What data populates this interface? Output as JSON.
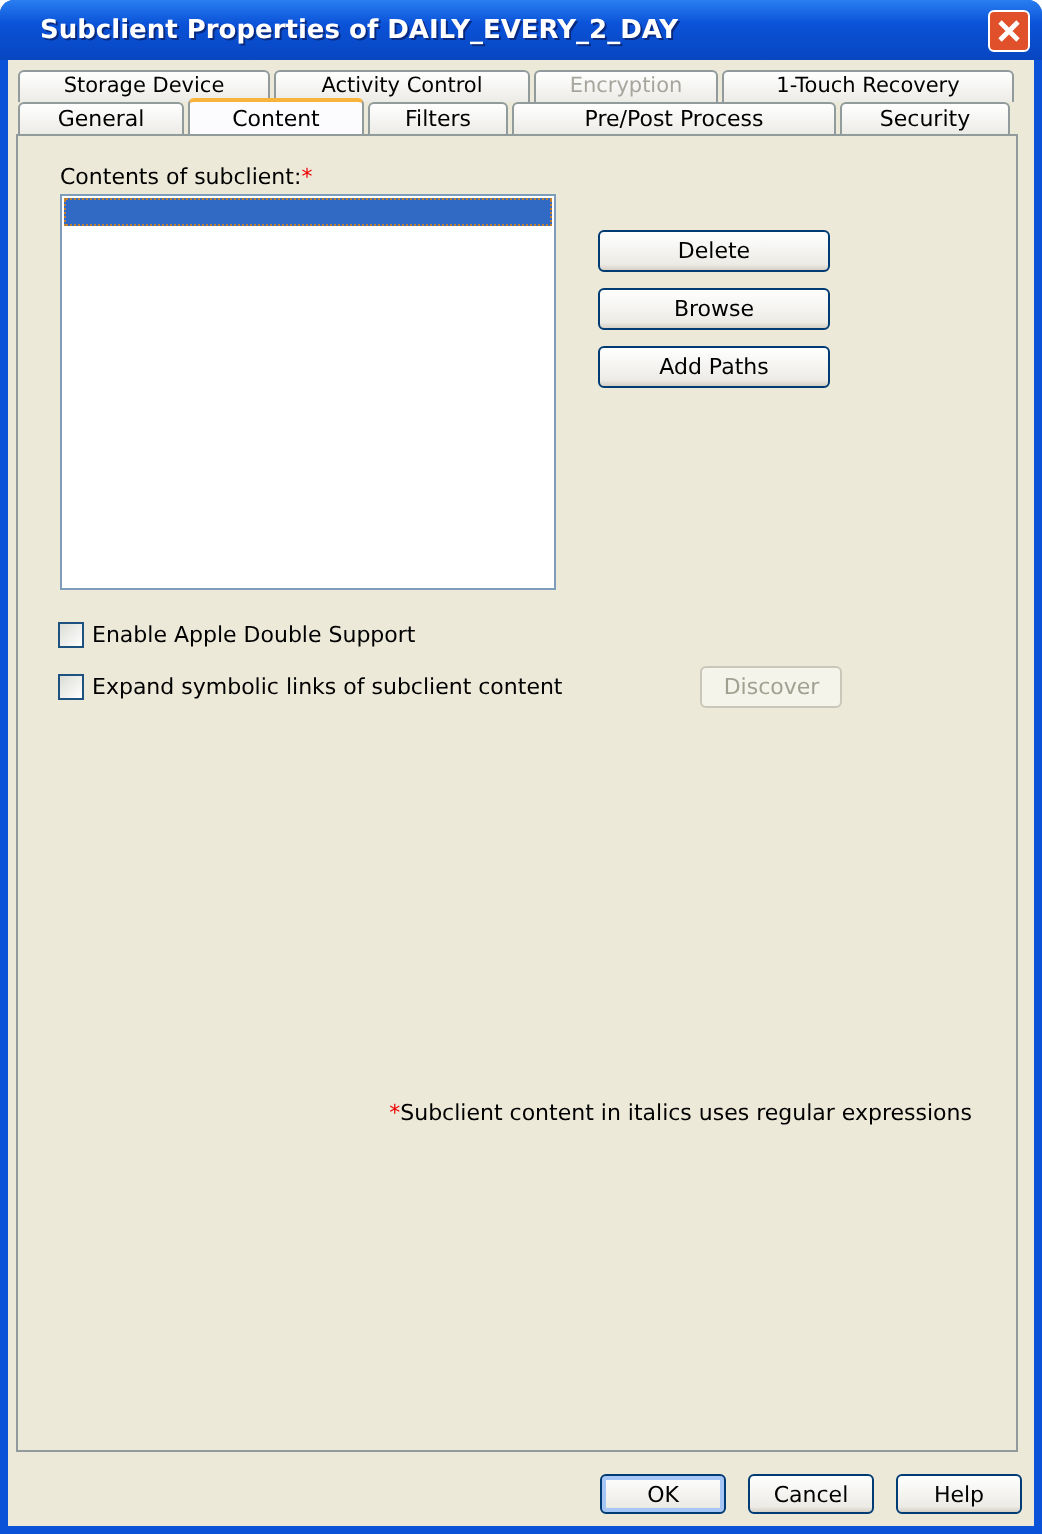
{
  "window": {
    "title": "Subclient Properties of DAILY_EVERY_2_DAY"
  },
  "tab_rows": [
    {
      "tabs": [
        {
          "label": "Storage Device",
          "selected": false,
          "disabled": false
        },
        {
          "label": "Activity Control",
          "selected": false,
          "disabled": false
        },
        {
          "label": "Encryption",
          "selected": false,
          "disabled": true
        },
        {
          "label": "1-Touch Recovery",
          "selected": false,
          "disabled": false
        }
      ]
    },
    {
      "tabs": [
        {
          "label": "General",
          "selected": false,
          "disabled": false
        },
        {
          "label": "Content",
          "selected": true,
          "disabled": false
        },
        {
          "label": "Filters",
          "selected": false,
          "disabled": false
        },
        {
          "label": "Pre/Post Process",
          "selected": false,
          "disabled": false
        },
        {
          "label": "Security",
          "selected": false,
          "disabled": false
        }
      ]
    }
  ],
  "contents": {
    "label": "Contents of subclient:",
    "required_mark": "*",
    "items": [
      {
        "selected": true
      }
    ]
  },
  "side_buttons": [
    {
      "label": "Delete",
      "disabled": false
    },
    {
      "label": "Browse",
      "disabled": false
    },
    {
      "label": "Add Paths",
      "disabled": false
    }
  ],
  "options": [
    {
      "label": "Enable Apple Double Support",
      "checked": false
    },
    {
      "label": "Expand symbolic links of subclient content",
      "checked": false,
      "button": {
        "label": "Discover",
        "disabled": true
      }
    }
  ],
  "note": {
    "mark": "*",
    "text": "Subclient content in italics uses regular expressions"
  },
  "buttons": [
    {
      "label": "OK",
      "default": true
    },
    {
      "label": "Cancel",
      "default": false
    },
    {
      "label": "Help",
      "default": false
    }
  ]
}
